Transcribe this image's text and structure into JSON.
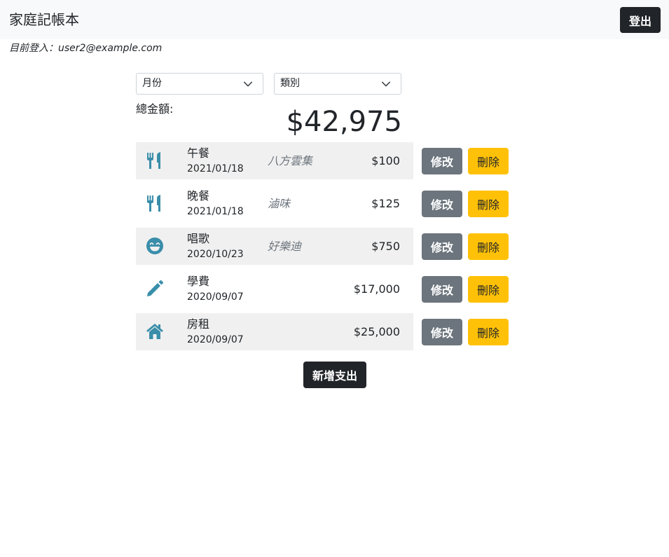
{
  "navbar": {
    "brand": "家庭記帳本",
    "logout_label": "登出"
  },
  "login": {
    "prefix": "目前登入：",
    "email": "user2@example.com"
  },
  "filters": {
    "month": "月份",
    "category": "類別"
  },
  "total": {
    "label": "總金額:",
    "amount": "$42,975"
  },
  "records": [
    {
      "icon": "utensils-icon",
      "name": "午餐",
      "date": "2021/01/18",
      "merchant": "八方雲集",
      "amount": "$100",
      "edit": "修改",
      "delete": "刪除"
    },
    {
      "icon": "utensils-icon",
      "name": "晚餐",
      "date": "2021/01/18",
      "merchant": "滷味",
      "amount": "$125",
      "edit": "修改",
      "delete": "刪除"
    },
    {
      "icon": "grin-icon",
      "name": "唱歌",
      "date": "2020/10/23",
      "merchant": "好樂迪",
      "amount": "$750",
      "edit": "修改",
      "delete": "刪除"
    },
    {
      "icon": "pen-icon",
      "name": "學費",
      "date": "2020/09/07",
      "merchant": "",
      "amount": "$17,000",
      "edit": "修改",
      "delete": "刪除"
    },
    {
      "icon": "home-icon",
      "name": "房租",
      "date": "2020/09/07",
      "merchant": "",
      "amount": "$25,000",
      "edit": "修改",
      "delete": "刪除"
    }
  ],
  "add_button": "新增支出",
  "colors": {
    "icon": "#3a8eaa",
    "navbar_bg": "#f8f9fa",
    "edit_bg": "#6c757d",
    "delete_bg": "#ffc107",
    "dark": "#212529"
  }
}
